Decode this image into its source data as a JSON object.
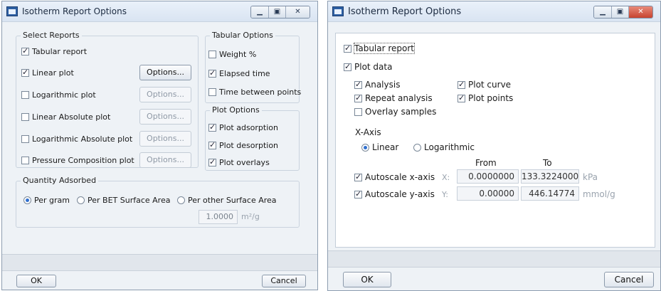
{
  "left": {
    "title": "Isotherm Report Options",
    "select_reports": {
      "legend": "Select Reports",
      "items": [
        {
          "label": "Tabular report",
          "checked": true
        },
        {
          "label": "Linear plot",
          "checked": true,
          "options": "Options...",
          "enabled": true
        },
        {
          "label": "Logarithmic plot",
          "checked": false,
          "options": "Options...",
          "enabled": false
        },
        {
          "label": "Linear Absolute plot",
          "checked": false,
          "options": "Options...",
          "enabled": false
        },
        {
          "label": "Logarithmic Absolute plot",
          "checked": false,
          "options": "Options...",
          "enabled": false
        },
        {
          "label": "Pressure Composition plot",
          "checked": false,
          "options": "Options...",
          "enabled": false
        }
      ]
    },
    "tabular_options": {
      "legend": "Tabular Options",
      "items": [
        {
          "label": "Weight %",
          "checked": false
        },
        {
          "label": "Elapsed time",
          "checked": true
        },
        {
          "label": "Time between points",
          "checked": false
        }
      ]
    },
    "plot_options": {
      "legend": "Plot Options",
      "items": [
        {
          "label": "Plot adsorption",
          "checked": true
        },
        {
          "label": "Plot desorption",
          "checked": true
        },
        {
          "label": "Plot overlays",
          "checked": true
        }
      ]
    },
    "quantity": {
      "legend": "Quantity Adsorbed",
      "options": [
        {
          "label": "Per gram",
          "selected": true
        },
        {
          "label": "Per BET Surface Area",
          "selected": false
        },
        {
          "label": "Per other Surface Area",
          "selected": false
        }
      ],
      "area_value": "1.0000",
      "area_unit": "m²/g"
    },
    "ok": "OK",
    "cancel": "Cancel"
  },
  "right": {
    "title": "Isotherm Report Options",
    "tabular_report": {
      "label": "Tabular report",
      "checked": true
    },
    "plot_data": {
      "label": "Plot data",
      "checked": true
    },
    "plot_items": [
      {
        "label": "Analysis",
        "checked": true
      },
      {
        "label": "Repeat analysis",
        "checked": true
      },
      {
        "label": "Overlay samples",
        "checked": false
      },
      {
        "label": "Plot curve",
        "checked": true
      },
      {
        "label": "Plot points",
        "checked": true
      }
    ],
    "xaxis_label": "X-Axis",
    "xaxis_options": [
      {
        "label": "Linear",
        "selected": true
      },
      {
        "label": "Logarithmic",
        "selected": false
      }
    ],
    "from_label": "From",
    "to_label": "To",
    "autoscale_x": {
      "label": "Autoscale x-axis",
      "checked": true,
      "axis": "X:",
      "from": "0.0000000",
      "to": "133.3224000",
      "unit": "kPa"
    },
    "autoscale_y": {
      "label": "Autoscale y-axis",
      "checked": true,
      "axis": "Y:",
      "from": "0.00000",
      "to": "446.14774",
      "unit": "mmol/g"
    },
    "ok": "OK",
    "cancel": "Cancel"
  }
}
